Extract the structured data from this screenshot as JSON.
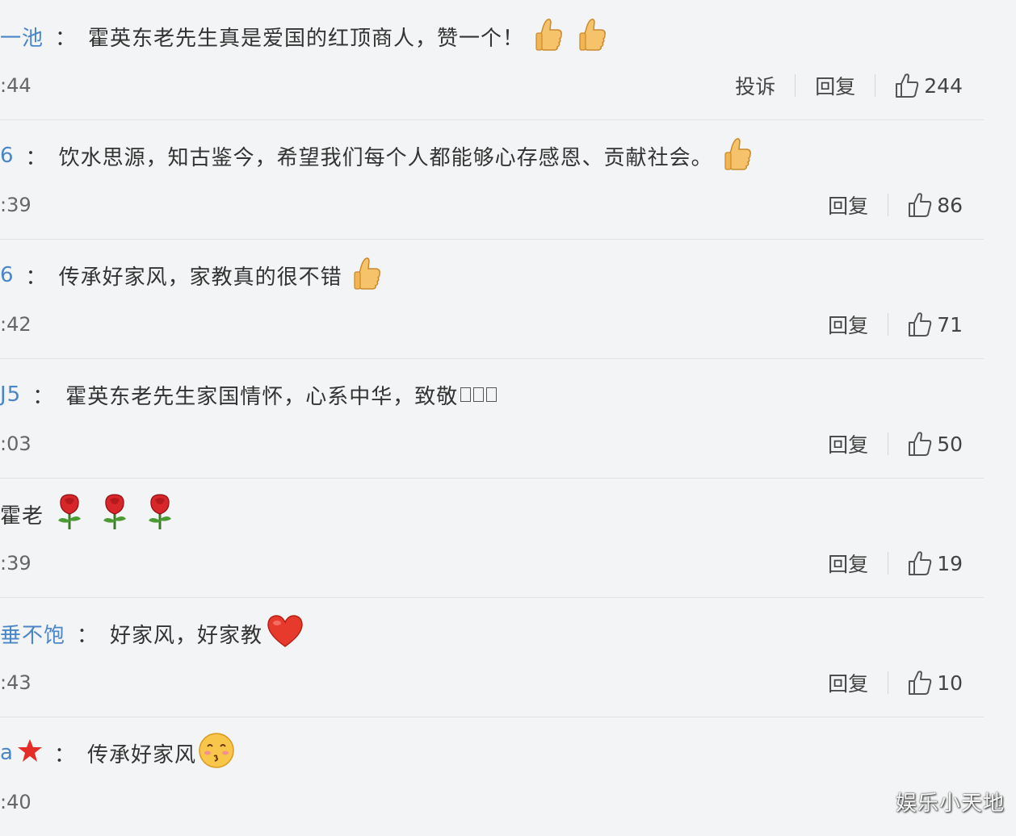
{
  "comments": [
    {
      "user": "一池",
      "text": "霍英东老先生真是爱国的红顶商人，赞一个！",
      "time": ":44",
      "report": "投诉",
      "reply": "回复",
      "likes": "244"
    },
    {
      "user": "6",
      "text": "饮水思源，知古鉴今，希望我们每个人都能够心存感恩、贡献社会。",
      "time": ":39",
      "reply": "回复",
      "likes": "86"
    },
    {
      "user": "6",
      "text": "传承好家风，家教真的很不错",
      "time": ":42",
      "reply": "回复",
      "likes": "71"
    },
    {
      "user": "J5",
      "text": "霍英东老先生家国情怀，心系中华，致敬",
      "time": ":03",
      "reply": "回复",
      "likes": "50"
    },
    {
      "user": "",
      "text": "霍老",
      "time": ":39",
      "reply": "回复",
      "likes": "19"
    },
    {
      "user": "垂不饱",
      "text": "好家风，好家教",
      "time": ":43",
      "reply": "回复",
      "likes": "10"
    },
    {
      "user": "a",
      "text": "传承好家风",
      "time": ":40"
    }
  ],
  "emojis": {
    "thumbs": "thumbs-up-emoji",
    "rose": "rose-emoji",
    "heart": "heart-emoji",
    "star": "star-emoji",
    "kiss": "kiss-face-emoji"
  },
  "colors": {
    "username": "#4a86c8",
    "background": "#f3f4f5",
    "divider": "#dfe1e4"
  },
  "watermark": "娱乐小天地"
}
